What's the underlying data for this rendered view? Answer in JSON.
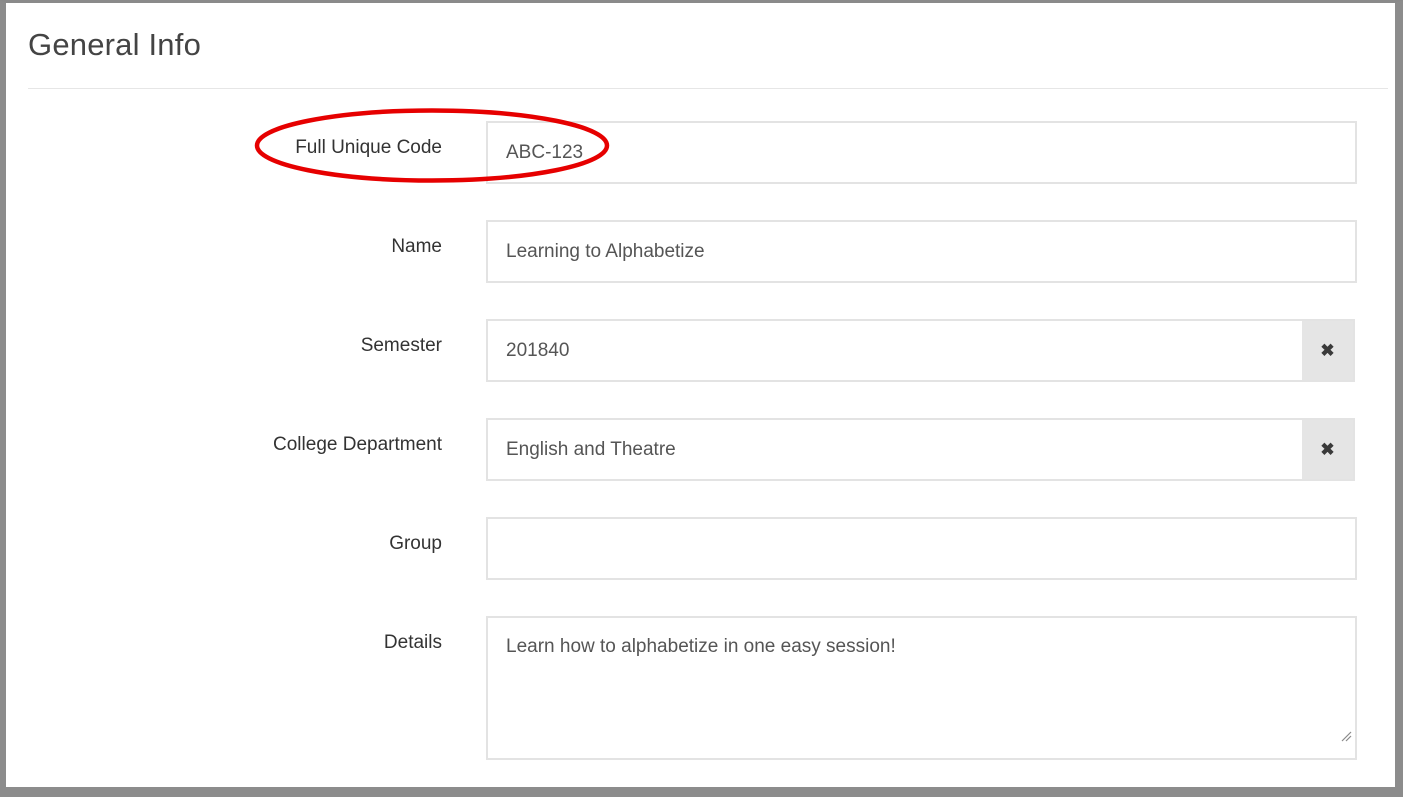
{
  "panel": {
    "title": "General Info"
  },
  "form": {
    "full_unique_code": {
      "label": "Full Unique Code",
      "value": "ABC-123"
    },
    "name": {
      "label": "Name",
      "value": "Learning to Alphabetize"
    },
    "semester": {
      "label": "Semester",
      "value": "201840",
      "clear_icon": "close-icon",
      "clear_glyph": "✖"
    },
    "college_department": {
      "label": "College Department",
      "value": "English and Theatre",
      "clear_icon": "close-icon",
      "clear_glyph": "✖"
    },
    "group": {
      "label": "Group",
      "value": ""
    },
    "details": {
      "label": "Details",
      "value": "Learn how to alphabetize in one easy session!"
    }
  },
  "annotation": {
    "highlight_color": "#e60000"
  },
  "colors": {
    "frame": "#8c8c8c",
    "field_border": "#e3e3e3",
    "clear_button_bg": "#e5e5e5",
    "text": "#555555",
    "label": "#333333"
  }
}
